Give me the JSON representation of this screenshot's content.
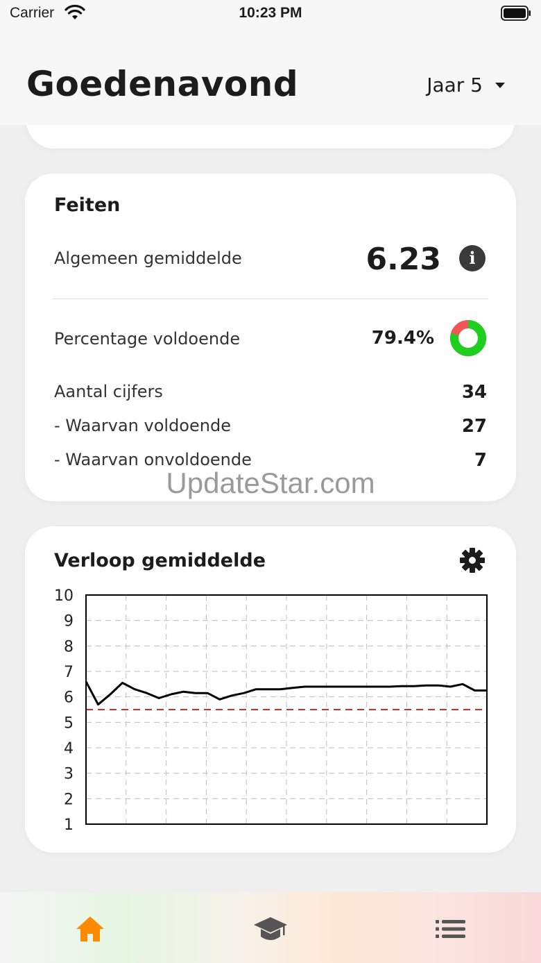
{
  "status_bar": {
    "carrier": "Carrier",
    "time": "10:23 PM"
  },
  "header": {
    "title": "Goedenavond",
    "year_selector": "Jaar 5"
  },
  "facts": {
    "title": "Feiten",
    "average_label": "Algemeen gemiddelde",
    "average_value": "6.23",
    "percentage_label": "Percentage voldoende",
    "percentage_value": "79.4%",
    "percentage_fraction": 0.794,
    "grade_count_label": "Aantal cijfers",
    "grade_count_value": "34",
    "sufficient_label": "- Waarvan voldoende",
    "sufficient_value": "27",
    "insufficient_label": "- Waarvan onvoldoende",
    "insufficient_value": "7"
  },
  "watermark": "UpdateStar.com",
  "graph": {
    "title": "Verloop gemiddelde"
  },
  "chart_data": {
    "type": "line",
    "ylim": [
      1,
      10
    ],
    "yticks": [
      "10",
      "9",
      "8",
      "7",
      "6",
      "5",
      "4",
      "3",
      "2",
      "1"
    ],
    "threshold": 5.5,
    "grid": true,
    "series": [
      {
        "values": [
          6.6,
          5.7,
          6.1,
          6.55,
          6.3,
          6.15,
          5.95,
          6.1,
          6.2,
          6.15,
          6.15,
          5.9,
          6.05,
          6.15,
          6.3,
          6.3,
          6.3,
          6.35,
          6.4,
          6.4,
          6.4,
          6.4,
          6.4,
          6.4,
          6.4,
          6.4,
          6.42,
          6.42,
          6.45,
          6.45,
          6.4,
          6.5,
          6.25,
          6.25
        ]
      }
    ]
  },
  "colors": {
    "accent": "#ff8a00",
    "pass": "#1fcf1f",
    "fail": "#f05656",
    "threshold_line": "#d62c2c",
    "tab_inactive": "#555555"
  },
  "tabs": [
    {
      "icon": "home-icon",
      "active": true
    },
    {
      "icon": "graduation-cap-icon",
      "active": false
    },
    {
      "icon": "list-icon",
      "active": false
    }
  ]
}
